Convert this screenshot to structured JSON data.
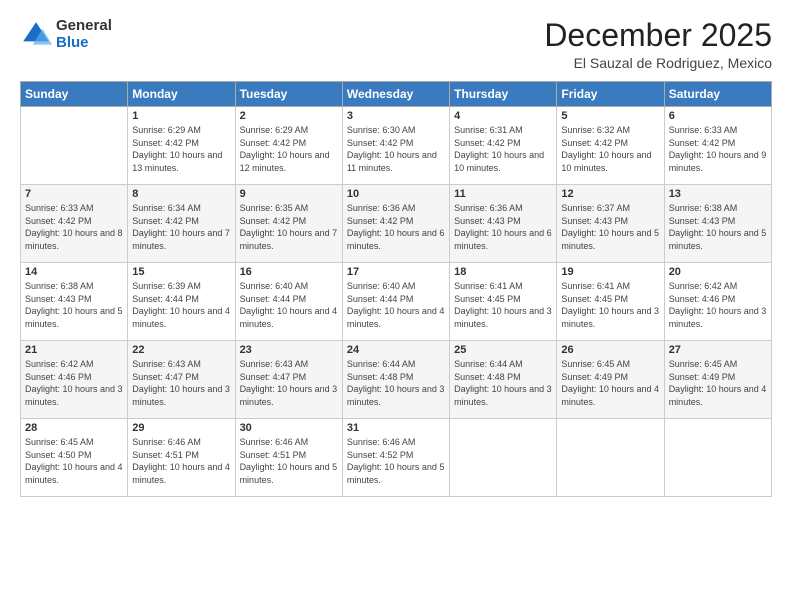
{
  "logo": {
    "general": "General",
    "blue": "Blue"
  },
  "title": "December 2025",
  "subtitle": "El Sauzal de Rodriguez, Mexico",
  "days_header": [
    "Sunday",
    "Monday",
    "Tuesday",
    "Wednesday",
    "Thursday",
    "Friday",
    "Saturday"
  ],
  "weeks": [
    [
      {
        "day": "",
        "sunrise": "",
        "sunset": "",
        "daylight": ""
      },
      {
        "day": "1",
        "sunrise": "Sunrise: 6:29 AM",
        "sunset": "Sunset: 4:42 PM",
        "daylight": "Daylight: 10 hours and 13 minutes."
      },
      {
        "day": "2",
        "sunrise": "Sunrise: 6:29 AM",
        "sunset": "Sunset: 4:42 PM",
        "daylight": "Daylight: 10 hours and 12 minutes."
      },
      {
        "day": "3",
        "sunrise": "Sunrise: 6:30 AM",
        "sunset": "Sunset: 4:42 PM",
        "daylight": "Daylight: 10 hours and 11 minutes."
      },
      {
        "day": "4",
        "sunrise": "Sunrise: 6:31 AM",
        "sunset": "Sunset: 4:42 PM",
        "daylight": "Daylight: 10 hours and 10 minutes."
      },
      {
        "day": "5",
        "sunrise": "Sunrise: 6:32 AM",
        "sunset": "Sunset: 4:42 PM",
        "daylight": "Daylight: 10 hours and 10 minutes."
      },
      {
        "day": "6",
        "sunrise": "Sunrise: 6:33 AM",
        "sunset": "Sunset: 4:42 PM",
        "daylight": "Daylight: 10 hours and 9 minutes."
      }
    ],
    [
      {
        "day": "7",
        "sunrise": "Sunrise: 6:33 AM",
        "sunset": "Sunset: 4:42 PM",
        "daylight": "Daylight: 10 hours and 8 minutes."
      },
      {
        "day": "8",
        "sunrise": "Sunrise: 6:34 AM",
        "sunset": "Sunset: 4:42 PM",
        "daylight": "Daylight: 10 hours and 7 minutes."
      },
      {
        "day": "9",
        "sunrise": "Sunrise: 6:35 AM",
        "sunset": "Sunset: 4:42 PM",
        "daylight": "Daylight: 10 hours and 7 minutes."
      },
      {
        "day": "10",
        "sunrise": "Sunrise: 6:36 AM",
        "sunset": "Sunset: 4:42 PM",
        "daylight": "Daylight: 10 hours and 6 minutes."
      },
      {
        "day": "11",
        "sunrise": "Sunrise: 6:36 AM",
        "sunset": "Sunset: 4:43 PM",
        "daylight": "Daylight: 10 hours and 6 minutes."
      },
      {
        "day": "12",
        "sunrise": "Sunrise: 6:37 AM",
        "sunset": "Sunset: 4:43 PM",
        "daylight": "Daylight: 10 hours and 5 minutes."
      },
      {
        "day": "13",
        "sunrise": "Sunrise: 6:38 AM",
        "sunset": "Sunset: 4:43 PM",
        "daylight": "Daylight: 10 hours and 5 minutes."
      }
    ],
    [
      {
        "day": "14",
        "sunrise": "Sunrise: 6:38 AM",
        "sunset": "Sunset: 4:43 PM",
        "daylight": "Daylight: 10 hours and 5 minutes."
      },
      {
        "day": "15",
        "sunrise": "Sunrise: 6:39 AM",
        "sunset": "Sunset: 4:44 PM",
        "daylight": "Daylight: 10 hours and 4 minutes."
      },
      {
        "day": "16",
        "sunrise": "Sunrise: 6:40 AM",
        "sunset": "Sunset: 4:44 PM",
        "daylight": "Daylight: 10 hours and 4 minutes."
      },
      {
        "day": "17",
        "sunrise": "Sunrise: 6:40 AM",
        "sunset": "Sunset: 4:44 PM",
        "daylight": "Daylight: 10 hours and 4 minutes."
      },
      {
        "day": "18",
        "sunrise": "Sunrise: 6:41 AM",
        "sunset": "Sunset: 4:45 PM",
        "daylight": "Daylight: 10 hours and 3 minutes."
      },
      {
        "day": "19",
        "sunrise": "Sunrise: 6:41 AM",
        "sunset": "Sunset: 4:45 PM",
        "daylight": "Daylight: 10 hours and 3 minutes."
      },
      {
        "day": "20",
        "sunrise": "Sunrise: 6:42 AM",
        "sunset": "Sunset: 4:46 PM",
        "daylight": "Daylight: 10 hours and 3 minutes."
      }
    ],
    [
      {
        "day": "21",
        "sunrise": "Sunrise: 6:42 AM",
        "sunset": "Sunset: 4:46 PM",
        "daylight": "Daylight: 10 hours and 3 minutes."
      },
      {
        "day": "22",
        "sunrise": "Sunrise: 6:43 AM",
        "sunset": "Sunset: 4:47 PM",
        "daylight": "Daylight: 10 hours and 3 minutes."
      },
      {
        "day": "23",
        "sunrise": "Sunrise: 6:43 AM",
        "sunset": "Sunset: 4:47 PM",
        "daylight": "Daylight: 10 hours and 3 minutes."
      },
      {
        "day": "24",
        "sunrise": "Sunrise: 6:44 AM",
        "sunset": "Sunset: 4:48 PM",
        "daylight": "Daylight: 10 hours and 3 minutes."
      },
      {
        "day": "25",
        "sunrise": "Sunrise: 6:44 AM",
        "sunset": "Sunset: 4:48 PM",
        "daylight": "Daylight: 10 hours and 3 minutes."
      },
      {
        "day": "26",
        "sunrise": "Sunrise: 6:45 AM",
        "sunset": "Sunset: 4:49 PM",
        "daylight": "Daylight: 10 hours and 4 minutes."
      },
      {
        "day": "27",
        "sunrise": "Sunrise: 6:45 AM",
        "sunset": "Sunset: 4:49 PM",
        "daylight": "Daylight: 10 hours and 4 minutes."
      }
    ],
    [
      {
        "day": "28",
        "sunrise": "Sunrise: 6:45 AM",
        "sunset": "Sunset: 4:50 PM",
        "daylight": "Daylight: 10 hours and 4 minutes."
      },
      {
        "day": "29",
        "sunrise": "Sunrise: 6:46 AM",
        "sunset": "Sunset: 4:51 PM",
        "daylight": "Daylight: 10 hours and 4 minutes."
      },
      {
        "day": "30",
        "sunrise": "Sunrise: 6:46 AM",
        "sunset": "Sunset: 4:51 PM",
        "daylight": "Daylight: 10 hours and 5 minutes."
      },
      {
        "day": "31",
        "sunrise": "Sunrise: 6:46 AM",
        "sunset": "Sunset: 4:52 PM",
        "daylight": "Daylight: 10 hours and 5 minutes."
      },
      {
        "day": "",
        "sunrise": "",
        "sunset": "",
        "daylight": ""
      },
      {
        "day": "",
        "sunrise": "",
        "sunset": "",
        "daylight": ""
      },
      {
        "day": "",
        "sunrise": "",
        "sunset": "",
        "daylight": ""
      }
    ]
  ]
}
